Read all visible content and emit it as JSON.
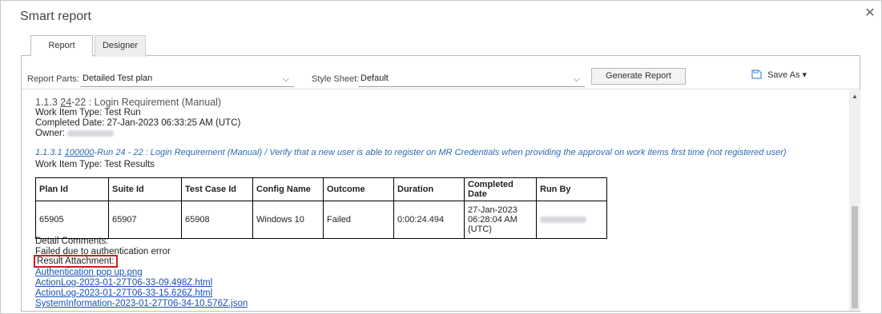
{
  "window": {
    "title": "Smart report",
    "close_glyph": "✕"
  },
  "tabs": [
    {
      "label": "Report",
      "active": true
    },
    {
      "label": "Designer",
      "active": false
    }
  ],
  "toolbar": {
    "report_parts_label": "Report Parts:",
    "report_parts_value": "Detailed Test plan",
    "style_sheet_label": "Style Sheet:",
    "style_sheet_value": "Default",
    "generate_label": "Generate Report",
    "save_as_label": "Save As",
    "save_as_icon": "save-icon",
    "dropdown_glyph": "⌵",
    "save_caret": "▾"
  },
  "report": {
    "run": {
      "prefix": "1.1.3 ",
      "id": "24",
      "suffix": "-22 : Login Requirement (Manual)",
      "work_item_type": "Work Item Type: Test Run",
      "completed_date": "Completed Date: 27-Jan-2023 06:33:25 AM (UTC)",
      "owner_label": "Owner:"
    },
    "result": {
      "prefix": "1.1.3.1 ",
      "id": "100000",
      "suffix": "-Run 24 - 22 : Login Requirement (Manual) / Verify that a new user is able to register on MR Credentials when providing the approval on work items first time (not registered user)",
      "work_item_type": "Work Item Type: Test Results"
    },
    "table": {
      "headers": [
        "Plan Id",
        "Suite Id",
        "Test Case Id",
        "Config Name",
        "Outcome",
        "Duration",
        "Completed Date",
        "Run By"
      ],
      "row": {
        "plan_id": "65905",
        "suite_id": "65907",
        "test_case_id": "65908",
        "config_name": "Windows 10",
        "outcome": "Failed",
        "duration": "0:00:24.494",
        "completed_date_l1": "27-Jan-2023",
        "completed_date_l2": "06:28:04 AM",
        "completed_date_l3": "(UTC)"
      }
    },
    "detail_comments_label": "Detail Comments:",
    "detail_comments_text": "Failed due to authentication error",
    "result_attachment_label": "Result Attachment:",
    "attachments": [
      "Authentication pop up.png",
      "ActionLog-2023-01-27T06-33-09.498Z.html",
      "ActionLog-2023-01-27T06-33-15.626Z.html",
      "SystemInformation-2023-01-27T06-34-10.576Z.json"
    ]
  },
  "scrollbar": {
    "up_glyph": "▲",
    "position_fraction": 0.97
  },
  "colors": {
    "link": "#1a4fb8",
    "highlight_box": "#d01c1c",
    "result_heading": "#2f6db0"
  }
}
